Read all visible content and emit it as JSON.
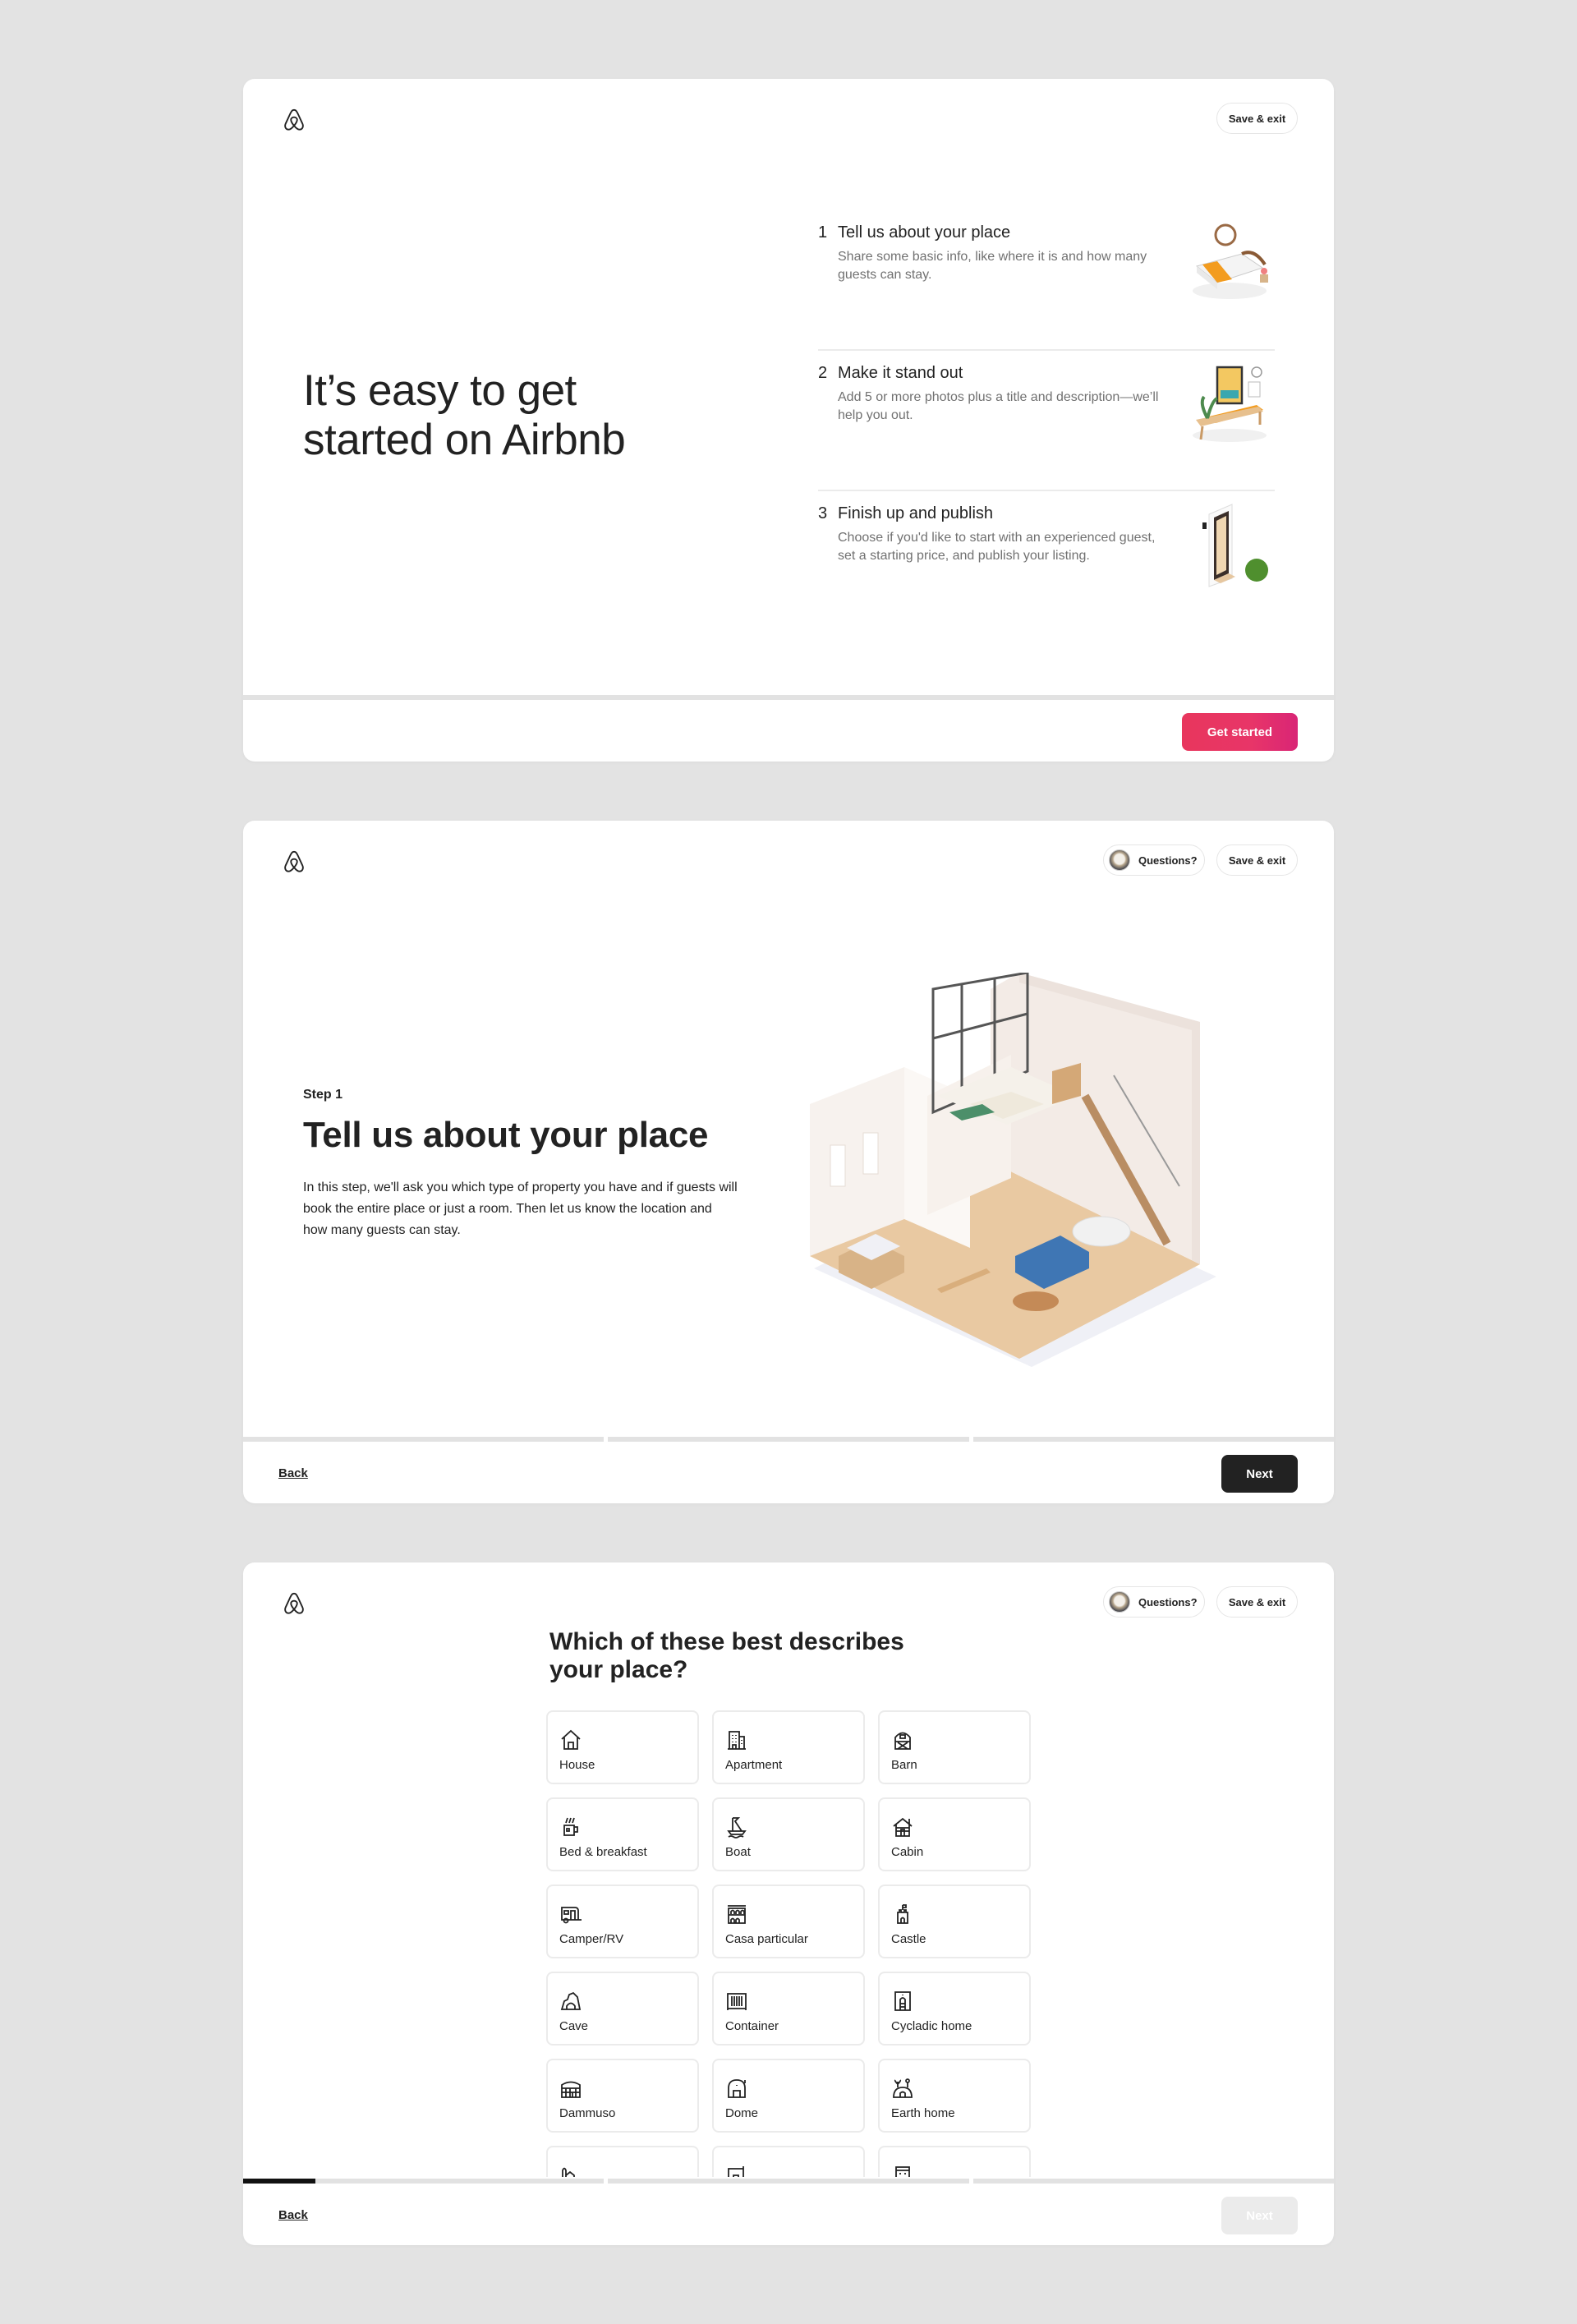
{
  "panel1": {
    "save_exit": "Save & exit",
    "hero_title_line1": "It’s easy to get",
    "hero_title_line2": "started on Airbnb",
    "steps": [
      {
        "num": "1",
        "title": "Tell us about your place",
        "desc": "Share some basic info, like where it is and how many guests can stay.",
        "illustration": "bed-illustration"
      },
      {
        "num": "2",
        "title": "Make it stand out",
        "desc": "Add 5 or more photos plus a title and description—we’ll help you out.",
        "illustration": "bench-illustration"
      },
      {
        "num": "3",
        "title": "Finish up and publish",
        "desc": "Choose if you'd like to start with an experienced guest, set a starting price, and publish your listing.",
        "illustration": "door-illustration"
      }
    ],
    "cta": "Get started",
    "cta_color": "#e61e4d"
  },
  "panel2": {
    "questions": "Questions?",
    "save_exit": "Save & exit",
    "step_label": "Step 1",
    "heading": "Tell us about your place",
    "body": "In this step, we'll ask you which type of property you have and if guests will book the entire place or just a room. Then let us know the location and how many guests can stay.",
    "back": "Back",
    "next": "Next",
    "progress": [
      0,
      0,
      0
    ]
  },
  "panel3": {
    "questions": "Questions?",
    "save_exit": "Save & exit",
    "title": "Which of these best describes your place?",
    "options": [
      {
        "label": "House",
        "icon": "house-icon"
      },
      {
        "label": "Apartment",
        "icon": "apartment-icon"
      },
      {
        "label": "Barn",
        "icon": "barn-icon"
      },
      {
        "label": "Bed & breakfast",
        "icon": "bed-breakfast-icon"
      },
      {
        "label": "Boat",
        "icon": "boat-icon"
      },
      {
        "label": "Cabin",
        "icon": "cabin-icon"
      },
      {
        "label": "Camper/RV",
        "icon": "camper-icon"
      },
      {
        "label": "Casa particular",
        "icon": "casa-particular-icon"
      },
      {
        "label": "Castle",
        "icon": "castle-icon"
      },
      {
        "label": "Cave",
        "icon": "cave-icon"
      },
      {
        "label": "Container",
        "icon": "container-icon"
      },
      {
        "label": "Cycladic home",
        "icon": "cycladic-home-icon"
      },
      {
        "label": "Dammuso",
        "icon": "dammuso-icon"
      },
      {
        "label": "Dome",
        "icon": "dome-icon"
      },
      {
        "label": "Earth home",
        "icon": "earth-home-icon"
      },
      {
        "label": "",
        "icon": "farm-icon"
      },
      {
        "label": "",
        "icon": "guesthouse-icon"
      },
      {
        "label": "",
        "icon": "hotel-icon"
      }
    ],
    "back": "Back",
    "next": "Next",
    "progress": [
      0.2,
      0,
      0
    ]
  }
}
